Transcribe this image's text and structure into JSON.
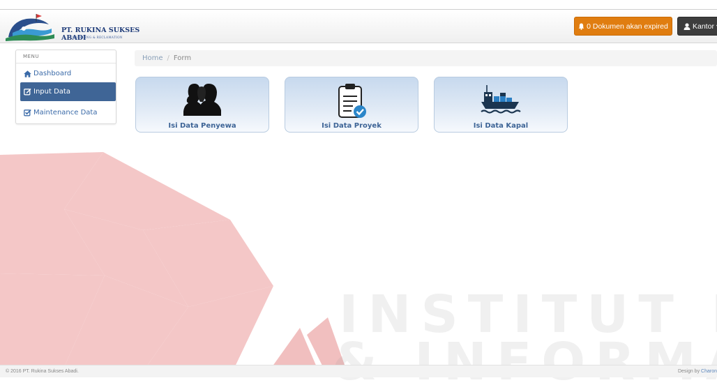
{
  "brand": {
    "name": "PT. RUKINA SUKSES ABADI",
    "tagline": "DREDGING & RECLAMATION"
  },
  "navbar": {
    "expired_button": {
      "icon": "bell-icon",
      "label": "0 Dokumen akan expired",
      "color": "#e07d10"
    },
    "user_button": {
      "icon": "user-icon",
      "label": "Kantor",
      "color": "#3d3d3d"
    }
  },
  "sidebar": {
    "title": "MENU",
    "items": [
      {
        "label": "Dashboard",
        "icon": "home-icon",
        "active": false
      },
      {
        "label": "Input Data",
        "icon": "edit-check-icon",
        "active": true
      },
      {
        "label": "Maintenance Data",
        "icon": "check-square-icon",
        "active": false
      }
    ],
    "active_color": "#3f6596"
  },
  "breadcrumb": {
    "home": "Home",
    "separator": "/",
    "current": "Form"
  },
  "tiles": [
    {
      "label": "Isi Data Penyewa",
      "icon": "users-icon"
    },
    {
      "label": "Isi Data Proyek",
      "icon": "clipboard-check-icon"
    },
    {
      "label": "Isi Data Kapal",
      "icon": "cargo-ship-icon"
    }
  ],
  "watermark": {
    "line1": "INSTITUT BISNIS",
    "line2": "& INFORMATIKA",
    "color": "#e87f7f"
  },
  "footer": {
    "copyright": "© 2016 PT. Rukina Sukses Abadi.",
    "credit_prefix": "Design by",
    "credit_name": "Charon"
  }
}
